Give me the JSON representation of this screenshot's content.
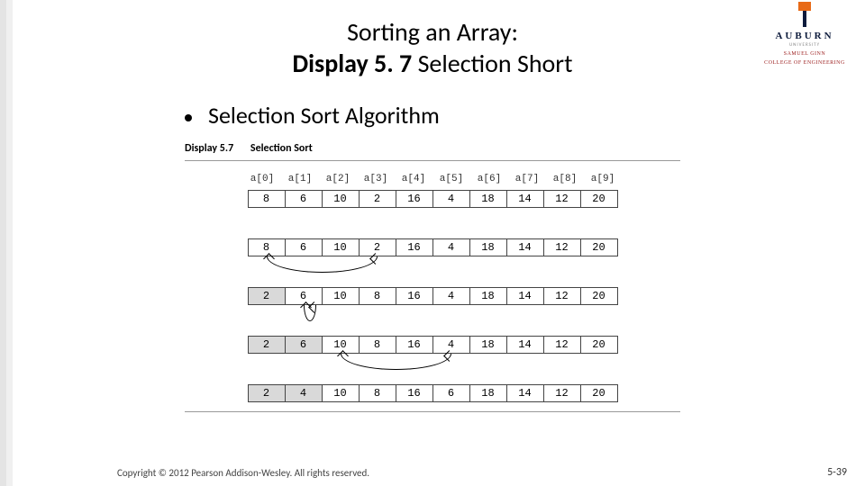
{
  "logo": {
    "word": "AUBURN",
    "sub": "UNIVERSITY",
    "college_line1": "SAMUEL GINN",
    "college_line2": "COLLEGE OF ENGINEERING"
  },
  "title": {
    "line1": "Sorting an Array:",
    "line2a": "Display 5. 7",
    "line2b": "  Selection Short"
  },
  "bullet": "Selection Sort Algorithm",
  "figure": {
    "caption_label": "Display 5.7",
    "caption_name": "Selection Sort",
    "indices": [
      "a[0]",
      "a[1]",
      "a[2]",
      "a[3]",
      "a[4]",
      "a[5]",
      "a[6]",
      "a[7]",
      "a[8]",
      "a[9]"
    ],
    "rows": [
      {
        "values": [
          8,
          6,
          10,
          2,
          16,
          4,
          18,
          14,
          12,
          20
        ],
        "shaded_to": 0,
        "swap": null
      },
      {
        "values": [
          8,
          6,
          10,
          2,
          16,
          4,
          18,
          14,
          12,
          20
        ],
        "shaded_to": 0,
        "swap": [
          0,
          3
        ]
      },
      {
        "values": [
          2,
          6,
          10,
          8,
          16,
          4,
          18,
          14,
          12,
          20
        ],
        "shaded_to": 1,
        "swap": [
          1,
          1
        ]
      },
      {
        "values": [
          2,
          6,
          10,
          8,
          16,
          4,
          18,
          14,
          12,
          20
        ],
        "shaded_to": 2,
        "swap": [
          2,
          5
        ]
      },
      {
        "values": [
          2,
          4,
          10,
          8,
          16,
          6,
          18,
          14,
          12,
          20
        ],
        "shaded_to": 2,
        "swap": null
      }
    ]
  },
  "copyright": "Copyright © 2012 Pearson Addison-Wesley. All rights reserved.",
  "page_number": "5-39"
}
